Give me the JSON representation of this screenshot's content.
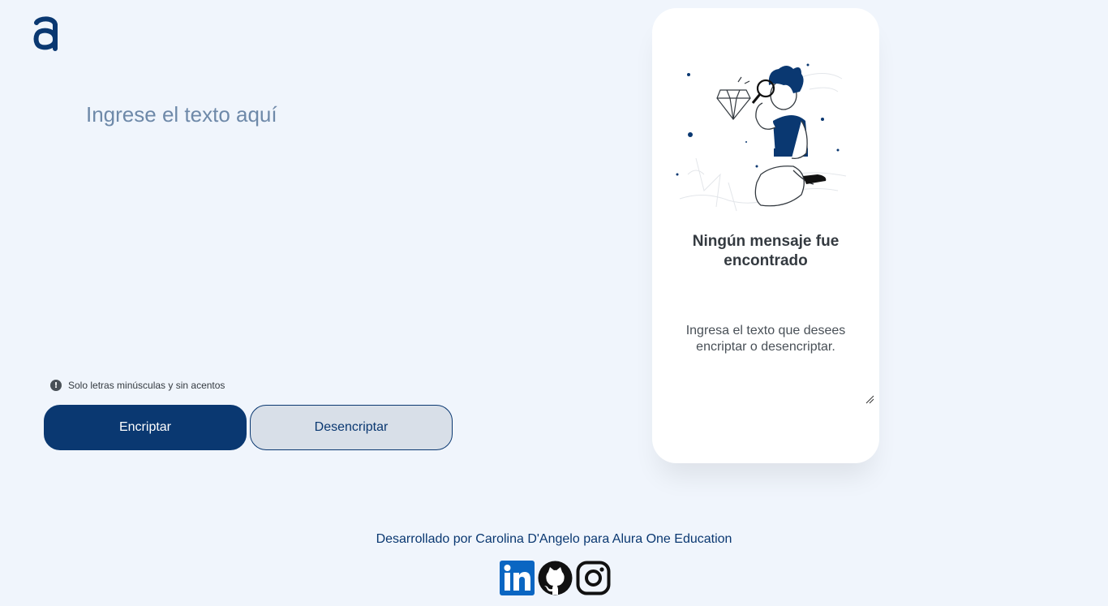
{
  "logo": {
    "icon": "alura-logo-icon",
    "color": "#0A3871"
  },
  "input": {
    "placeholder": "Ingrese el texto aquí",
    "value": ""
  },
  "hint": {
    "icon": "exclamation-circle-icon",
    "text": "Solo letras minúsculas y sin acentos"
  },
  "buttons": {
    "encrypt_label": "Encriptar",
    "decrypt_label": "Desencriptar"
  },
  "output_card": {
    "illustration": "person-with-magnifying-glass-icon",
    "title": "Ningún mensaje fue encontrado",
    "message": "Ingresa el texto que desees encriptar o desencriptar."
  },
  "footer": {
    "credit": "Desarrollado por Carolina D'Angelo para Alura One Education",
    "social": [
      {
        "name": "linkedin-icon"
      },
      {
        "name": "github-icon"
      },
      {
        "name": "instagram-icon"
      }
    ]
  },
  "colors": {
    "primary": "#0A3871",
    "background": "#F0F5FC",
    "secondary_button": "#D8DFE8"
  }
}
